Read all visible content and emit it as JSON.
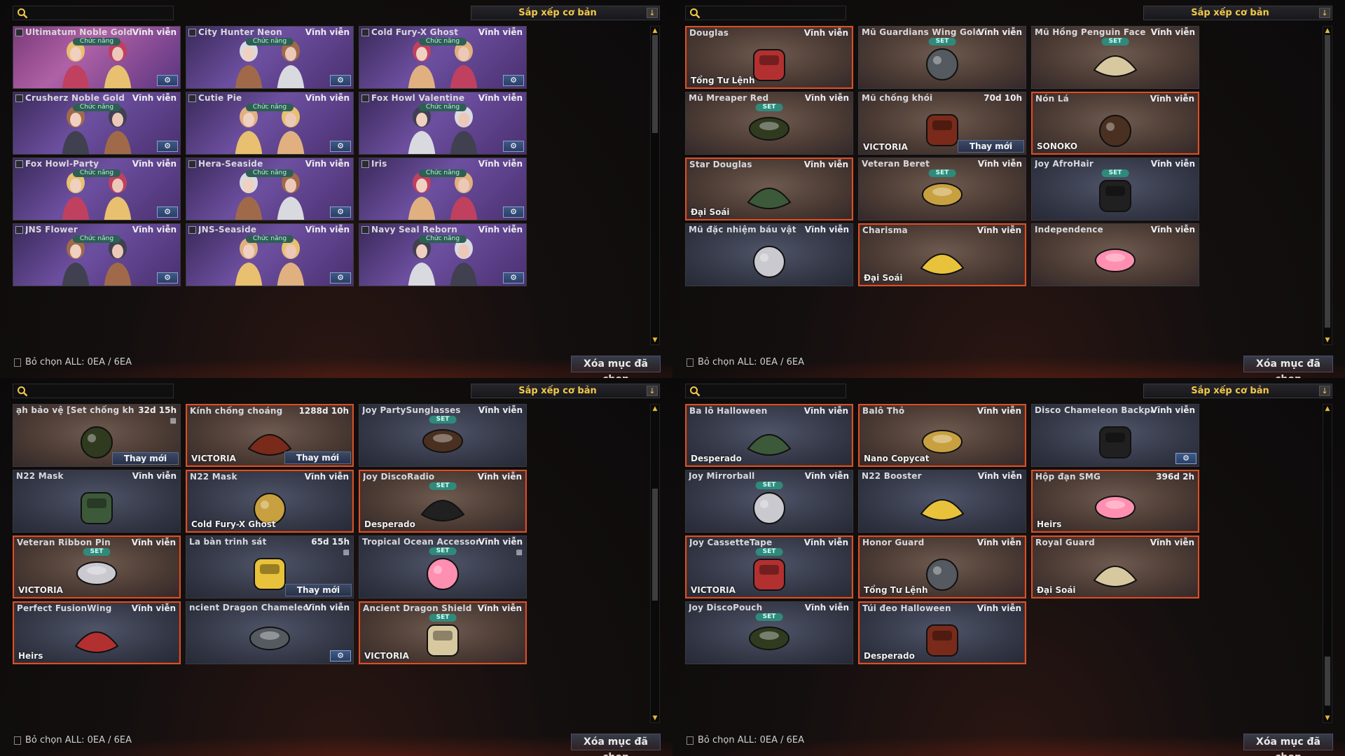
{
  "common": {
    "sort_label": "Sắp xếp cơ bản",
    "footer_text": "Bỏ chọn ALL: 0EA / 6EA",
    "delete_label": "Xóa mục đã chọn",
    "renew_label": "Thay mới",
    "icons": {
      "search": "search-icon",
      "sort": "arrow-down-icon",
      "gear": "gear-icon",
      "lock": "lock-icon",
      "checkbox": "checkbox-icon"
    }
  },
  "colors": {
    "accent_gold": "#f2c84a",
    "selected_border": "#d0542e",
    "set_badge": "#2f8a7c"
  },
  "panels": [
    {
      "name": "characters",
      "items": [
        {
          "name": "Ultimatum Noble Gold",
          "duration": "Vĩnh viễn",
          "tag": "Chức năng",
          "bg": "pink"
        },
        {
          "name": "City Hunter Neon",
          "duration": "Vĩnh viễn",
          "tag": "Chức năng",
          "bg": "purple"
        },
        {
          "name": "Cold Fury-X Ghost",
          "duration": "Vĩnh viễn",
          "tag": "Chức năng",
          "bg": "purple"
        },
        {
          "name": "Crusherz Noble Gold",
          "duration": "Vĩnh viễn",
          "tag": "Chức năng",
          "bg": "purple"
        },
        {
          "name": "Cutie Pie",
          "duration": "Vĩnh viễn",
          "tag": "Chức năng",
          "bg": "purple"
        },
        {
          "name": "Fox Howl Valentine",
          "duration": "Vĩnh viễn",
          "tag": "Chức năng",
          "bg": "purple"
        },
        {
          "name": "Fox Howl-Party",
          "duration": "Vĩnh viễn",
          "tag": "Chức năng",
          "bg": "purple"
        },
        {
          "name": "Hera-Seaside",
          "duration": "Vĩnh viễn",
          "tag": "Chức năng",
          "bg": "purple"
        },
        {
          "name": "Iris",
          "duration": "Vĩnh viễn",
          "tag": "Chức năng",
          "bg": "purple"
        },
        {
          "name": "JNS Flower",
          "duration": "Vĩnh viễn",
          "tag": "Chức năng",
          "bg": "purple"
        },
        {
          "name": "JNS-Seaside",
          "duration": "Vĩnh viễn",
          "tag": "Chức năng",
          "bg": "purple"
        },
        {
          "name": "Navy Seal Reborn",
          "duration": "Vĩnh viễn",
          "tag": "Chức năng",
          "bg": "purple"
        }
      ]
    },
    {
      "name": "headgear",
      "items": [
        {
          "name": "Douglas",
          "duration": "Vĩnh viễn",
          "owner": "Tổng Tư Lệnh",
          "bg": "brown",
          "selected": true
        },
        {
          "name": "Mũ Guardians Wing Gold",
          "duration": "Vĩnh viễn",
          "tag": "SET",
          "bg": "brown"
        },
        {
          "name": "Mũ Hồng Penguin Face",
          "duration": "Vĩnh viễn",
          "tag": "SET",
          "bg": "brown"
        },
        {
          "name": "Mũ Mreaper Red",
          "duration": "Vĩnh viễn",
          "tag": "SET",
          "bg": "brown"
        },
        {
          "name": "Mũ chống khói",
          "duration": "70d 10h",
          "owner": "VICTORIA",
          "renew": true,
          "bg": "brown"
        },
        {
          "name": "Nón Lá",
          "duration": "Vĩnh viễn",
          "owner": "SONOKO",
          "bg": "brown",
          "selected": true
        },
        {
          "name": "Star Douglas",
          "duration": "Vĩnh viễn",
          "owner": "Đại Soái",
          "bg": "brown",
          "selected": true
        },
        {
          "name": "Veteran Beret",
          "duration": "Vĩnh viễn",
          "tag": "SET",
          "bg": "brown"
        },
        {
          "name": "Joy AfroHair",
          "duration": "Vĩnh viễn",
          "tag": "SET",
          "bg": "blue"
        },
        {
          "name": "Mũ đặc nhiệm báu vật",
          "duration": "Vĩnh viễn",
          "bg": "blue"
        },
        {
          "name": "Charisma",
          "duration": "Vĩnh viễn",
          "owner": "Đại Soái",
          "bg": "brown",
          "selected": true
        },
        {
          "name": "Independence",
          "duration": "Vĩnh viễn",
          "bg": "brown"
        }
      ]
    },
    {
      "name": "accessories",
      "items": [
        {
          "name": "ạh bảo vệ [Set chống khủng bố]",
          "duration": "32d 15h",
          "renew": true,
          "lock": true,
          "bg": "brown"
        },
        {
          "name": "Kính chống choáng",
          "duration": "1288d 10h",
          "owner": "VICTORIA",
          "renew": true,
          "bg": "brown",
          "selected": true
        },
        {
          "name": "Joy PartySunglasses",
          "duration": "Vĩnh viễn",
          "tag": "SET",
          "bg": "blue"
        },
        {
          "name": "N22 Mask",
          "duration": "Vĩnh viễn",
          "bg": "blue"
        },
        {
          "name": "N22 Mask",
          "duration": "Vĩnh viễn",
          "owner": "Cold Fury-X Ghost",
          "bg": "blue",
          "selected": true
        },
        {
          "name": "Joy DiscoRadio",
          "duration": "Vĩnh viễn",
          "tag": "SET",
          "owner": "Desperado",
          "bg": "brown",
          "selected": true
        },
        {
          "name": "Veteran Ribbon Pin",
          "duration": "Vĩnh viễn",
          "tag": "SET",
          "owner": "VICTORIA",
          "bg": "brown",
          "selected": true
        },
        {
          "name": "La bàn trinh sát",
          "duration": "65d 15h",
          "renew": true,
          "lock": true,
          "bg": "blue"
        },
        {
          "name": "Tropical Ocean Accessory",
          "duration": "Vĩnh viễn",
          "tag": "SET",
          "lock": true,
          "bg": "blue"
        },
        {
          "name": "Perfect FusionWing",
          "duration": "Vĩnh viễn",
          "owner": "Heirs",
          "bg": "blue",
          "selected": true
        },
        {
          "name": "ncient Dragon Chameleon Backpacl",
          "duration": "Vĩnh viễn",
          "gear": true,
          "bg": "blue"
        },
        {
          "name": "Ancient Dragon Shield",
          "duration": "Vĩnh viễn",
          "tag": "SET",
          "owner": "VICTORIA",
          "bg": "brown",
          "selected": true
        }
      ]
    },
    {
      "name": "backpacks",
      "items": [
        {
          "name": "Ba lô Halloween",
          "duration": "Vĩnh viễn",
          "owner": "Desperado",
          "bg": "blue",
          "selected": true
        },
        {
          "name": "Balô Thỏ",
          "duration": "Vĩnh viễn",
          "owner": "Nano Copycat",
          "bg": "brown",
          "selected": true
        },
        {
          "name": "Disco Chameleon Backpack",
          "duration": "Vĩnh viễn",
          "gear": true,
          "bg": "blue"
        },
        {
          "name": "Joy Mirrorball",
          "duration": "Vĩnh viễn",
          "tag": "SET",
          "bg": "blue"
        },
        {
          "name": "N22 Booster",
          "duration": "Vĩnh viễn",
          "bg": "blue"
        },
        {
          "name": "Hộp đạn SMG",
          "duration": "396d 2h",
          "owner": "Heirs",
          "bg": "brown",
          "selected": true
        },
        {
          "name": "Joy CassetteTape",
          "duration": "Vĩnh viễn",
          "tag": "SET",
          "owner": "VICTORIA",
          "bg": "blue",
          "selected": true
        },
        {
          "name": "Honor Guard",
          "duration": "Vĩnh viễn",
          "owner": "Tổng Tư Lệnh",
          "bg": "brown",
          "selected": true
        },
        {
          "name": "Royal Guard",
          "duration": "Vĩnh viễn",
          "owner": "Đại Soái",
          "bg": "brown",
          "selected": true
        },
        {
          "name": "Joy DiscoPouch",
          "duration": "Vĩnh viễn",
          "tag": "SET",
          "bg": "blue"
        },
        {
          "name": "Túi đeo Halloween",
          "duration": "Vĩnh viễn",
          "owner": "Desperado",
          "bg": "blue",
          "selected": true
        }
      ]
    }
  ]
}
